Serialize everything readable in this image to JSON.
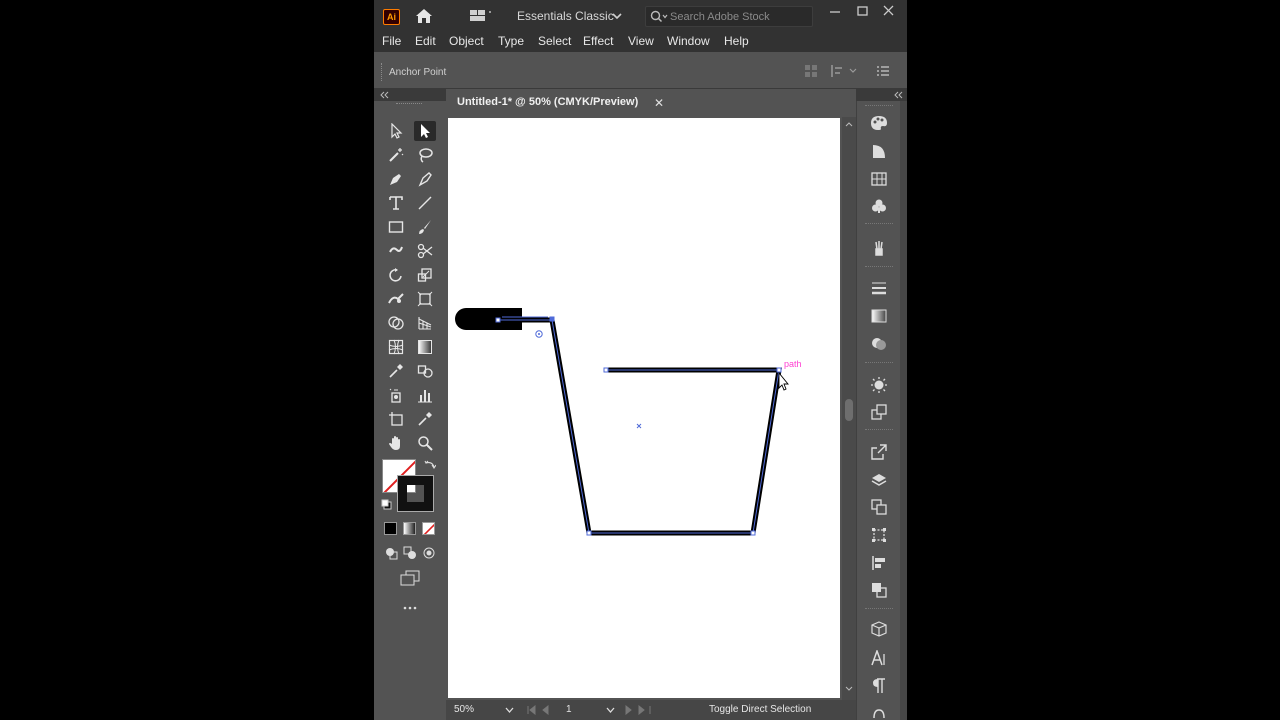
{
  "app": {
    "logo_text": "Ai",
    "workspace": "Essentials Classic",
    "search_placeholder": "Search Adobe Stock"
  },
  "menu": [
    "File",
    "Edit",
    "Object",
    "Type",
    "Select",
    "Effect",
    "View",
    "Window",
    "Help"
  ],
  "control_bar": {
    "label": "Anchor Point"
  },
  "document": {
    "tab_title": "Untitled-1* @ 50% (CMYK/Preview)",
    "close_glyph": "✕",
    "smart_guide_label": "path"
  },
  "status_bar": {
    "zoom": "50%",
    "page": "1",
    "status_text": "Toggle Direct Selection"
  },
  "colors": {
    "accent_selection": "#4f6ad8",
    "smart_guide": "#ff3fd2",
    "logo_border": "#ff7c00"
  }
}
